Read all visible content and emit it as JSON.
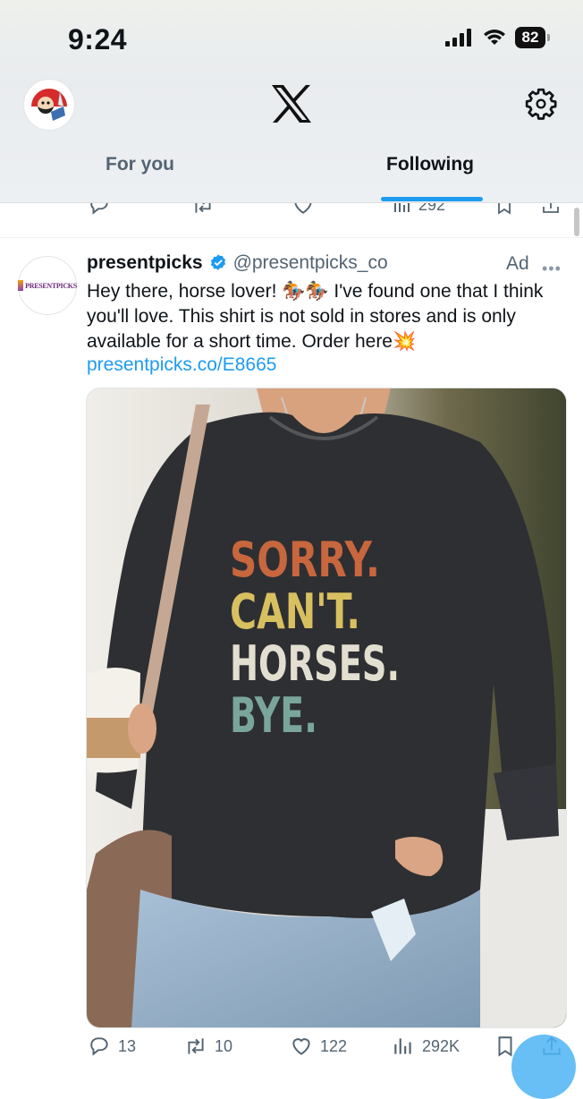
{
  "status_bar": {
    "time": "9:24",
    "battery": "82"
  },
  "header": {
    "tabs": [
      {
        "label": "For you",
        "active": false
      },
      {
        "label": "Following",
        "active": true
      }
    ]
  },
  "prev_tweet": {
    "views": "292"
  },
  "tweet": {
    "display_name": "presentpicks",
    "handle": "@presentpicks_co",
    "ad_label": "Ad",
    "avatar_text": "PRESENTPICKS",
    "text": "Hey there, horse lover! 🏇🏇 I've found one that I think you'll love.  This shirt is not sold in stores and is only available for a short time. Order here💥",
    "link": "presentpicks.co/E8665",
    "shirt_lines": [
      "SORRY.",
      "CAN'T.",
      "HORSES.",
      "BYE."
    ],
    "stats": {
      "replies": "13",
      "reposts": "10",
      "likes": "122",
      "views": "292K"
    }
  },
  "colors": {
    "accent": "#1d9bf0",
    "muted": "#536471"
  },
  "icons": [
    "x-logo-icon",
    "gear-icon",
    "reply-icon",
    "repost-icon",
    "like-icon",
    "views-icon",
    "bookmark-icon",
    "share-icon",
    "verified-badge-icon"
  ]
}
